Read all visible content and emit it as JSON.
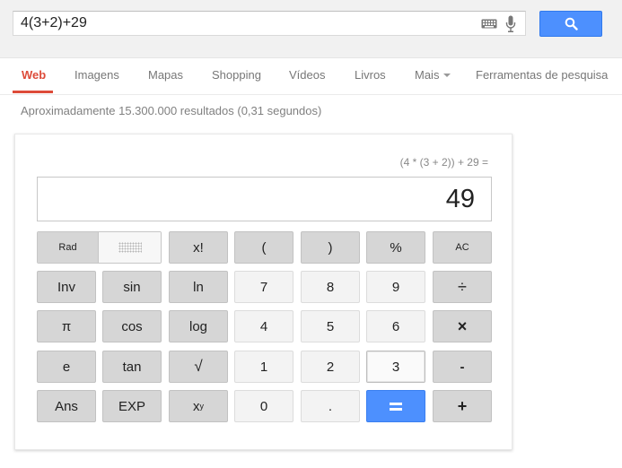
{
  "search": {
    "query": "4(3+2)+29",
    "keyboard_icon": "keyboard-icon",
    "mic_icon": "microphone-icon",
    "button_icon": "search-icon",
    "button_color": "#4d90fe"
  },
  "nav": {
    "tabs": [
      {
        "label": "Web",
        "active": true
      },
      {
        "label": "Imagens"
      },
      {
        "label": "Mapas"
      },
      {
        "label": "Shopping"
      },
      {
        "label": "Vídeos"
      },
      {
        "label": "Livros"
      },
      {
        "label": "Mais"
      },
      {
        "label": "Ferramentas de pesquisa"
      }
    ],
    "active_color": "#dd4b39"
  },
  "results": {
    "count_text": "Aproximadamente 15.300.000 resultados (0,31 segundos)"
  },
  "calculator": {
    "expression": "(4 * (3 + 2)) + 29 =",
    "display": "49",
    "mode_label": "Rad",
    "keys": {
      "fact": "x!",
      "lparen": "(",
      "rparen": ")",
      "percent": "%",
      "ac": "AC",
      "inv": "Inv",
      "sin": "sin",
      "ln": "ln",
      "seven": "7",
      "eight": "8",
      "nine": "9",
      "divide": "÷",
      "pi": "π",
      "cos": "cos",
      "log": "log",
      "four": "4",
      "five": "5",
      "six": "6",
      "multiply": "×",
      "e": "e",
      "tan": "tan",
      "sqrt": "√",
      "one": "1",
      "two": "2",
      "three": "3",
      "minus": "-",
      "ans": "Ans",
      "exp": "EXP",
      "pow_base": "x",
      "pow_sup": "y",
      "zero": "0",
      "dot": ".",
      "plus": "+"
    },
    "equals_icon": "equals-icon"
  }
}
